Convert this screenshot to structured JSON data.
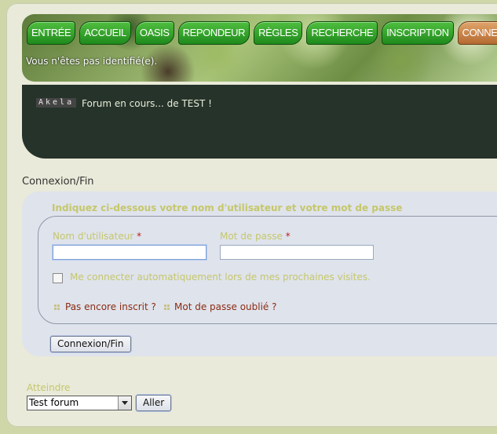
{
  "nav": {
    "items": [
      {
        "label": "ENTRÉE"
      },
      {
        "label": "ACCUEIL"
      },
      {
        "label": "OASIS"
      },
      {
        "label": "REPONDEUR"
      },
      {
        "label": "RÈGLES"
      },
      {
        "label": "RECHERCHE"
      },
      {
        "label": "INSCRIPTION"
      },
      {
        "label": "CONNEXION/FIN"
      }
    ]
  },
  "header": {
    "status_text": "Vous n'êtes pas identifié(e)."
  },
  "banner": {
    "logo_text": "Akela",
    "tagline": "Forum en cours... de TEST !"
  },
  "page": {
    "title": "Connexion/Fin"
  },
  "login": {
    "instructions": "Indiquez ci-dessous votre nom d'utilisateur et votre mot de passe",
    "username_label": "Nom d'utilisateur",
    "password_label": "Mot de passe",
    "required_mark": "*",
    "username_value": "",
    "password_value": "",
    "autologin_label": "Me connecter automatiquement lors de mes prochaines visites.",
    "autologin_checked": false,
    "register_link": "Pas encore inscrit ?",
    "forgot_link": "Mot de passe oublié ?",
    "submit_label": "Connexion/Fin"
  },
  "jump": {
    "label": "Atteindre",
    "selected": "Test forum",
    "go_label": "Aller"
  },
  "colors": {
    "nav_green": "#1f8a1c",
    "nav_active": "#b56b32",
    "banner_bg": "#26332a",
    "label_yellow": "#c5c76a",
    "link_red": "#8a2c12",
    "panel_bg": "#dfe3ec"
  }
}
